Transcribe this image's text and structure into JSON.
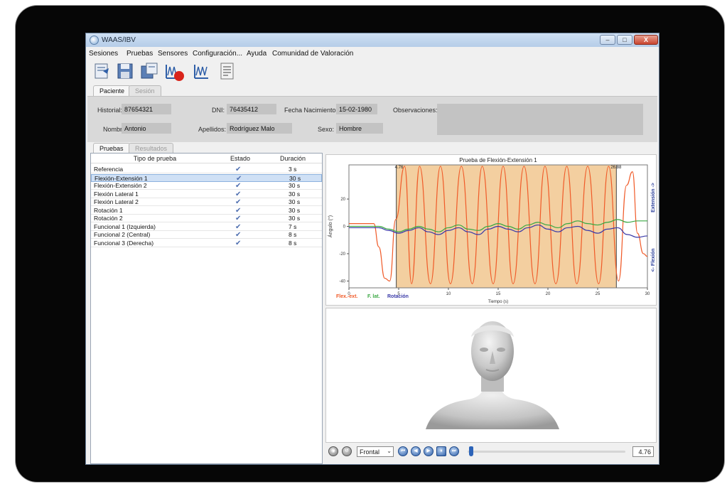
{
  "window": {
    "title": "WAAS/IBV",
    "minimize": "–",
    "maximize": "□",
    "close": "X"
  },
  "menu": [
    "Sesiones",
    "Pruebas",
    "Sensores",
    "Configuración...",
    "Ayuda",
    "Comunidad de Valoración"
  ],
  "toolbar": {
    "icons": [
      "new-session-icon",
      "save-icon",
      "export-icon",
      "record-test-icon",
      "analysis-icon",
      "report-icon"
    ]
  },
  "top_tabs": [
    "Paciente",
    "Sesión"
  ],
  "patient": {
    "historial_label": "Historial:",
    "historial": "87654321",
    "dni_label": "DNI:",
    "dni": "76435412",
    "fecha_label": "Fecha Nacimiento:",
    "fecha": "15-02-1980",
    "observaciones_label": "Observaciones:",
    "observaciones": "",
    "nombre_label": "Nombre:",
    "nombre": "Antonio",
    "apellidos_label": "Apellidos:",
    "apellidos": "Rodríguez Malo",
    "sexo_label": "Sexo:",
    "sexo": "Hombre"
  },
  "lower_tabs": [
    "Pruebas",
    "Resultados"
  ],
  "tests": {
    "columns": [
      "Tipo de prueba",
      "Estado",
      "Duración"
    ],
    "rows": [
      {
        "name": "Referencia",
        "duration": "3 s"
      },
      {
        "name": "Flexión-Extensión 1",
        "duration": "30 s"
      },
      {
        "name": "Flexión-Extensión 2",
        "duration": "30 s"
      },
      {
        "name": "Flexión Lateral 1",
        "duration": "30 s"
      },
      {
        "name": "Flexión Lateral 2",
        "duration": "30 s"
      },
      {
        "name": "Rotación 1",
        "duration": "30 s"
      },
      {
        "name": "Rotación 2",
        "duration": "30 s"
      },
      {
        "name": "Funcional 1 (Izquierda)",
        "duration": "7 s"
      },
      {
        "name": "Funcional 2 (Central)",
        "duration": "8 s"
      },
      {
        "name": "Funcional 3 (Derecha)",
        "duration": "8 s"
      }
    ],
    "selected_index": 1,
    "status_icon": "checkmark-icon"
  },
  "chart_data": {
    "type": "line",
    "title": "Prueba de Flexión-Extensión 1",
    "xlabel": "Tiempo (s)",
    "ylabel": "Ángulo (°)",
    "right_label_top": "Extensión ->",
    "right_label_bottom": "<- Flexión",
    "xlim": [
      0,
      30
    ],
    "ylim": [
      -45,
      45
    ],
    "xticks": [
      0,
      5,
      10,
      15,
      20,
      25,
      30
    ],
    "yticks": [
      -40,
      -20,
      0,
      20
    ],
    "highlight_region": {
      "start": 4.76,
      "end": 26.88,
      "start_label": "4.76",
      "end_label": "26.88",
      "color": "#f3cfa0"
    },
    "legend": [
      "Flex.-ext.",
      "F. lat.",
      "Rotación"
    ],
    "series": [
      {
        "name": "Flex.-ext.",
        "color": "#f05a28",
        "x": [
          0,
          1.5,
          2.5,
          3,
          3.6,
          4.1,
          4.7,
          5.6,
          6.3,
          7.1,
          8.2,
          9.2,
          10.2,
          11.3,
          12.4,
          13.4,
          14.5,
          15.5,
          16.5,
          17.6,
          18.7,
          19.7,
          20.8,
          21.9,
          22.9,
          24.0,
          25.1,
          26.1,
          27.1,
          27.9,
          28.5,
          29.0,
          29.6,
          30
        ],
        "y": [
          2,
          2,
          2,
          -15,
          -38,
          -40,
          5,
          44,
          -42,
          44,
          -42,
          44,
          -42,
          44,
          -42,
          44,
          -42,
          44,
          -42,
          44,
          -42,
          44,
          -42,
          44,
          -42,
          44,
          -42,
          44,
          -40,
          30,
          40,
          -5,
          -20,
          -22
        ]
      },
      {
        "name": "F. lat.",
        "color": "#3aa843",
        "x": [
          0,
          2,
          3,
          4,
          5,
          6,
          7,
          8,
          9,
          10,
          11,
          12,
          13,
          14,
          15,
          16,
          17,
          18,
          19,
          20,
          21,
          22,
          23,
          24,
          25,
          26,
          27,
          28,
          29,
          30
        ],
        "y": [
          0,
          0,
          0,
          -2,
          -4,
          -2,
          0,
          -2,
          -4,
          -1,
          1,
          -2,
          -3,
          0,
          2,
          0,
          -2,
          1,
          3,
          1,
          -1,
          2,
          4,
          2,
          1,
          3,
          5,
          3,
          4,
          4
        ]
      },
      {
        "name": "Rotación",
        "color": "#3a3aa8",
        "x": [
          0,
          2,
          3,
          4,
          5,
          6,
          7,
          8,
          9,
          10,
          11,
          12,
          13,
          14,
          15,
          16,
          17,
          18,
          19,
          20,
          21,
          22,
          23,
          24,
          25,
          26,
          27,
          28,
          29,
          30
        ],
        "y": [
          -1,
          -1,
          -1,
          -3,
          -5,
          -3,
          -1,
          -4,
          -6,
          -3,
          -1,
          -4,
          -6,
          -2,
          0,
          -2,
          -4,
          -1,
          1,
          -2,
          -4,
          -1,
          0,
          -3,
          -5,
          -2,
          -1,
          -6,
          -8,
          -7
        ]
      }
    ]
  },
  "viewer": {
    "view_select": "Frontal",
    "time_value": "4.76",
    "slider_position": 0.16
  }
}
